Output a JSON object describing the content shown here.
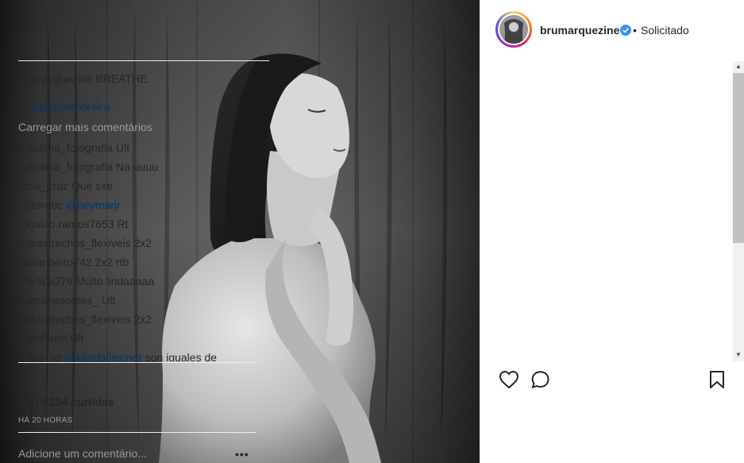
{
  "post": {
    "username": "brumarquezine",
    "separator": "•",
    "follow_state": "Solicitado",
    "verified_icon": "verified-badge-icon",
    "accent": "#3897f0"
  },
  "caption": {
    "user": "brumarquezine",
    "text": "BREATHE.",
    "credit_prefix": "by",
    "credit_mention": "@brucamoreira"
  },
  "load_more": "Carregar mais comentários",
  "comments": [
    {
      "user": "netolima_fotografia",
      "text": "Ult"
    },
    {
      "user": "netolima_fotografia",
      "text": "Na uuuu"
    },
    {
      "user": "jucie_cruz",
      "text": "Que sxe"
    },
    {
      "user": "victorebc",
      "mention": "@neymarjr"
    },
    {
      "user": "ronaldo.ramos7653",
      "text": "Rt"
    },
    {
      "user": "frasestrechos_flexiveis",
      "text": "2x2"
    },
    {
      "user": "karlaribeiro742",
      "text": "2x2 rtb"
    },
    {
      "user": "marlice279",
      "text": "Muito lindaaaaa"
    },
    {
      "user": "eubrunasoares_",
      "text": "Ult"
    },
    {
      "user": "frasestrechos_flexiveis",
      "text": "2x2"
    },
    {
      "user": "istanforriri",
      "text": "Ult"
    },
    {
      "user": "salito_vz",
      "mention": "@kendallienner",
      "text": "son iguales de"
    }
  ],
  "actions": {
    "like_icon": "heart-icon",
    "comment_icon": "comment-icon",
    "save_icon": "bookmark-icon"
  },
  "likes": "1.619.234 curtidas",
  "time": "HÁ 20 HORAS",
  "comment_box": {
    "placeholder": "Adicione um comentário...",
    "more": "•••"
  }
}
